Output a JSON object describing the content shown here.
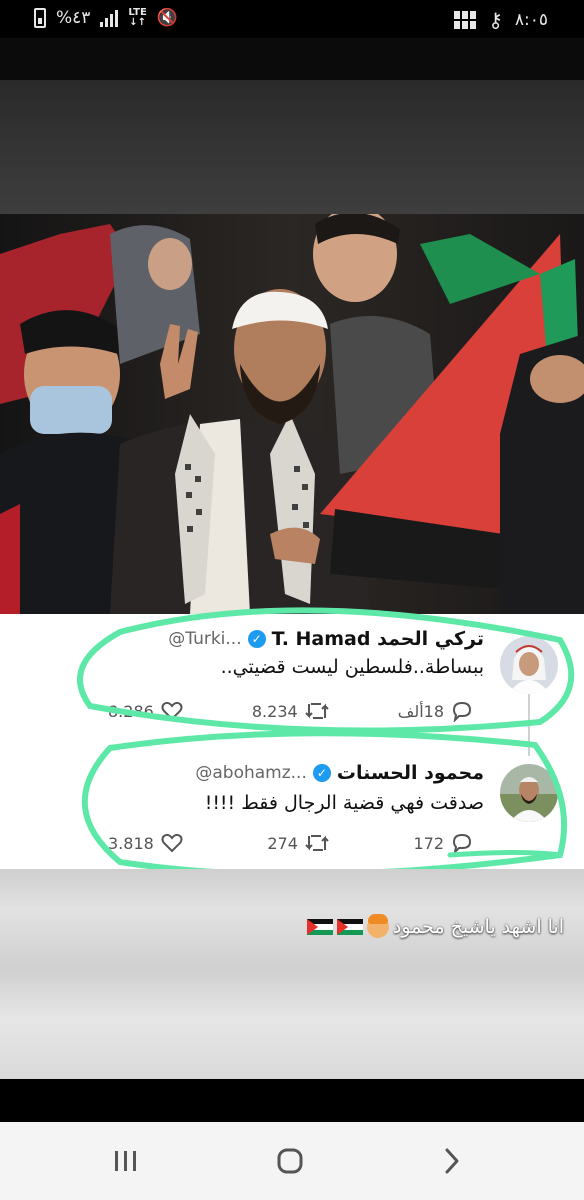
{
  "status_bar": {
    "time": "٨:٠٥",
    "battery_percent": "%٤٣",
    "network": "LTE",
    "network_arrows": "↓↑",
    "battery_icon": "battery-icon",
    "signal_icon": "signal-icon",
    "mute_icon": "mute-icon",
    "notification_icon": "gallery-notification-icon",
    "key_icon": "key-icon"
  },
  "tweets": [
    {
      "name": "تركي الحمد T. Hamad",
      "handle": "@Turki...",
      "text": "ببساطة..فلسطين ليست قضيتي..",
      "replies": "18ألف",
      "retweets": "8.234",
      "likes": "8.286"
    },
    {
      "name": "محمود الحسنات",
      "handle": "@abohamz...",
      "text": "صدقت فهي قضية الرجال فقط !!!!",
      "replies": "172",
      "retweets": "274",
      "likes": "3.818"
    }
  ],
  "caption": {
    "text": "انا اشهد ياشيخ محمود"
  },
  "colors": {
    "marker_green": "#5ee8a8",
    "verified_blue": "#1d9bf0",
    "flag_red": "#e4312b",
    "flag_green": "#149954"
  },
  "nav_bar": {
    "recents_icon": "recents-icon",
    "home_icon": "home-icon",
    "back_icon": "back-icon"
  }
}
